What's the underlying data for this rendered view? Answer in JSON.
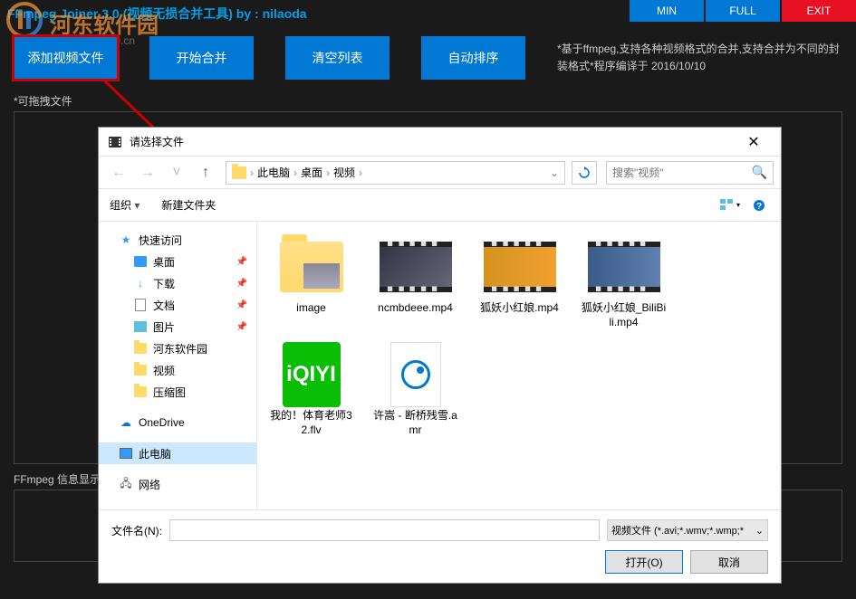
{
  "app": {
    "title": "FFmpeg Joiner 3.0 (视频无损合并工具)  by : nilaoda",
    "min": "MIN",
    "full": "FULL",
    "exit": "EXIT"
  },
  "watermark": {
    "text": "河东软件园",
    "url": "www.pc0359.cn"
  },
  "toolbar": {
    "add_video": "添加视频文件",
    "start_merge": "开始合并",
    "clear_list": "清空列表",
    "auto_sort": "自动排序",
    "info": "*基于ffmpeg,支持各种视频格式的合并,支持合并为不同的封装格式*程序编译于 2016/10/10"
  },
  "labels": {
    "drag": "*可拖拽文件",
    "ffmpeg": "FFmpeg 信息显示:"
  },
  "dialog": {
    "title": "请选择文件",
    "breadcrumb": {
      "pc": "此电脑",
      "desktop": "桌面",
      "video": "视频"
    },
    "search_placeholder": "搜索\"视频\"",
    "organize": "组织",
    "new_folder": "新建文件夹",
    "sidebar": {
      "quick_access": "快速访问",
      "desktop": "桌面",
      "downloads": "下载",
      "documents": "文档",
      "pictures": "图片",
      "hedong": "河东软件园",
      "video": "视频",
      "compressed": "压缩图",
      "onedrive": "OneDrive",
      "this_pc": "此电脑",
      "network": "网络"
    },
    "files": [
      {
        "name": "image",
        "type": "folder"
      },
      {
        "name": "ncmbdeee.mp4",
        "type": "video1"
      },
      {
        "name": "狐妖小红娘.mp4",
        "type": "video2"
      },
      {
        "name": "狐妖小红娘_BiliBili.mp4",
        "type": "video3"
      },
      {
        "name": "我的！体育老师32.flv",
        "type": "iqiyi"
      },
      {
        "name": "许嵩 - 断桥残雪.amr",
        "type": "audio"
      }
    ],
    "filename_label": "文件名(N):",
    "filter": "视频文件 (*.avi;*.wmv;*.wmp;*",
    "open": "打开(O)",
    "cancel": "取消"
  }
}
